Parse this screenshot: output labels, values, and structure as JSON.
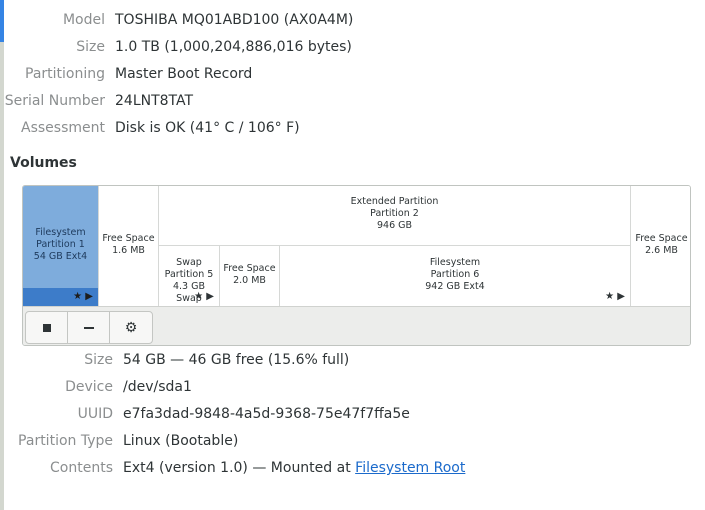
{
  "disk_info": [
    {
      "label": "Model",
      "value": "TOSHIBA MQ01ABD100 (AX0A4M)"
    },
    {
      "label": "Size",
      "value": "1.0 TB (1,000,204,886,016 bytes)"
    },
    {
      "label": "Partitioning",
      "value": "Master Boot Record"
    },
    {
      "label": "Serial Number",
      "value": "24LNT8TAT"
    },
    {
      "label": "Assessment",
      "value": "Disk is OK (41° C / 106° F)"
    }
  ],
  "volumes_title": "Volumes",
  "volumes": {
    "partition1": {
      "line1": "Filesystem",
      "line2": "Partition 1",
      "line3": "54 GB Ext4",
      "selected": true
    },
    "free1": {
      "line1": "Free Space",
      "line2": "1.6 MB"
    },
    "extended": {
      "line1": "Extended Partition",
      "line2": "Partition 2",
      "line3": "946 GB"
    },
    "swap": {
      "line1": "Swap",
      "line2": "Partition 5",
      "line3": "4.3 GB Swap"
    },
    "free2": {
      "line1": "Free Space",
      "line2": "2.0 MB"
    },
    "partition6": {
      "line1": "Filesystem",
      "line2": "Partition 6",
      "line3": "942 GB Ext4"
    },
    "free3": {
      "line1": "Free Space",
      "line2": "2.6 MB"
    },
    "mount_marker": "★ ▶"
  },
  "toolbar": {
    "stop_icon": "stop-icon",
    "remove_icon": "minus-icon",
    "settings_icon": "gear-icon",
    "settings_glyph": "⚙"
  },
  "volume_info": [
    {
      "label": "Size",
      "value": "54 GB — 46 GB free (15.6% full)"
    },
    {
      "label": "Device",
      "value": "/dev/sda1"
    },
    {
      "label": "UUID",
      "value": "e7fa3dad-9848-4a5d-9368-75e47f7ffa5e"
    },
    {
      "label": "Partition Type",
      "value": "Linux (Bootable)"
    }
  ],
  "contents": {
    "label": "Contents",
    "text": "Ext4 (version 1.0) — Mounted at ",
    "link": "Filesystem Root"
  },
  "colors": {
    "accent": "#3584e4",
    "selected_volume": "#7eacdc",
    "selected_bar": "#3d7cc9",
    "link": "#1b6acb"
  }
}
